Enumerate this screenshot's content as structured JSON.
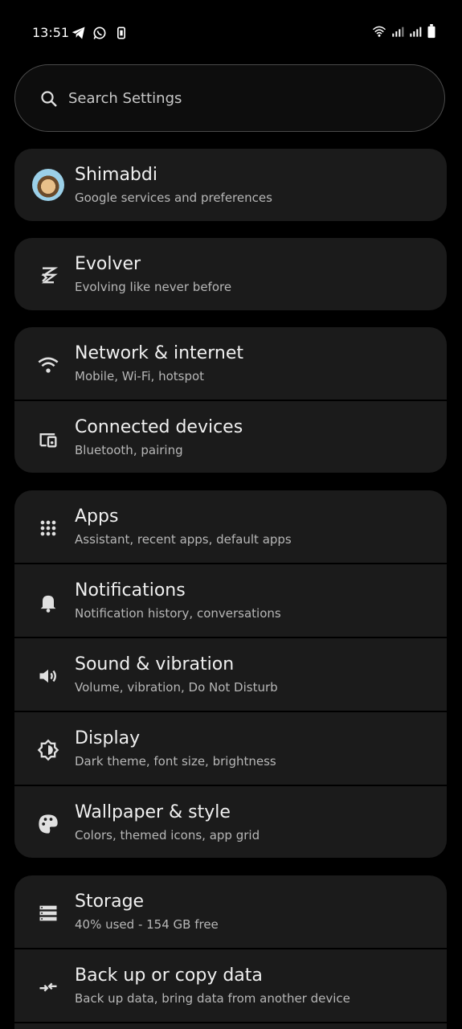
{
  "status": {
    "time": "13:51",
    "left_icons": [
      "telegram-icon",
      "whatsapp-icon",
      "battery-saver-icon"
    ],
    "right_icons": [
      "wifi-icon",
      "signal-icon",
      "signal-icon",
      "battery-icon"
    ]
  },
  "search": {
    "placeholder": "Search Settings"
  },
  "sections": [
    {
      "items": [
        {
          "title": "Shimabdi",
          "subtitle": "Google services and preferences",
          "icon": "avatar"
        }
      ]
    },
    {
      "items": [
        {
          "title": "Evolver",
          "subtitle": "Evolving like never before",
          "icon": "evolver-icon"
        }
      ]
    },
    {
      "items": [
        {
          "title": "Network & internet",
          "subtitle": "Mobile, Wi-Fi, hotspot",
          "icon": "wifi-icon"
        },
        {
          "title": "Connected devices",
          "subtitle": "Bluetooth, pairing",
          "icon": "devices-icon"
        }
      ]
    },
    {
      "items": [
        {
          "title": "Apps",
          "subtitle": "Assistant, recent apps, default apps",
          "icon": "apps-grid-icon"
        },
        {
          "title": "Notifications",
          "subtitle": "Notification history, conversations",
          "icon": "bell-icon"
        },
        {
          "title": "Sound & vibration",
          "subtitle": "Volume, vibration, Do Not Disturb",
          "icon": "speaker-icon"
        },
        {
          "title": "Display",
          "subtitle": "Dark theme, font size, brightness",
          "icon": "brightness-icon"
        },
        {
          "title": "Wallpaper & style",
          "subtitle": "Colors, themed icons, app grid",
          "icon": "palette-icon"
        }
      ]
    },
    {
      "items": [
        {
          "title": "Storage",
          "subtitle": "40% used - 154 GB free",
          "icon": "storage-icon"
        },
        {
          "title": "Back up or copy data",
          "subtitle": "Back up data, bring data from another device",
          "icon": "backup-icon"
        }
      ]
    }
  ],
  "colors": {
    "background": "#000000",
    "card": "#1b1b1b",
    "text": "#f0f0f0",
    "subtext": "#b7b7b7"
  }
}
